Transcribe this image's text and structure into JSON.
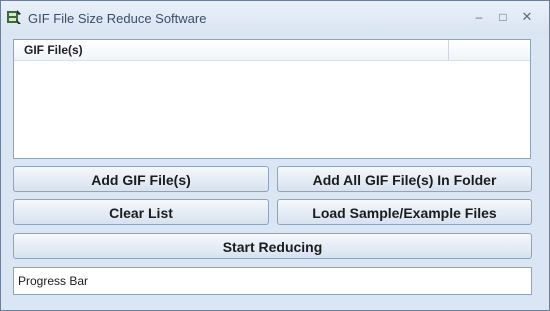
{
  "window": {
    "title": "GIF File Size Reduce Software",
    "app_icon": "app-icon",
    "controls": {
      "minimize": "–",
      "maximize": "□",
      "close": "✕"
    }
  },
  "file_list": {
    "columns": [
      "GIF File(s)"
    ],
    "rows": []
  },
  "buttons": {
    "add_gif_files": "Add GIF File(s)",
    "add_all_in_folder": "Add All GIF File(s) In Folder",
    "clear_list": "Clear List",
    "load_sample": "Load Sample/Example Files",
    "start_reducing": "Start Reducing"
  },
  "progress": {
    "label": "Progress Bar"
  }
}
